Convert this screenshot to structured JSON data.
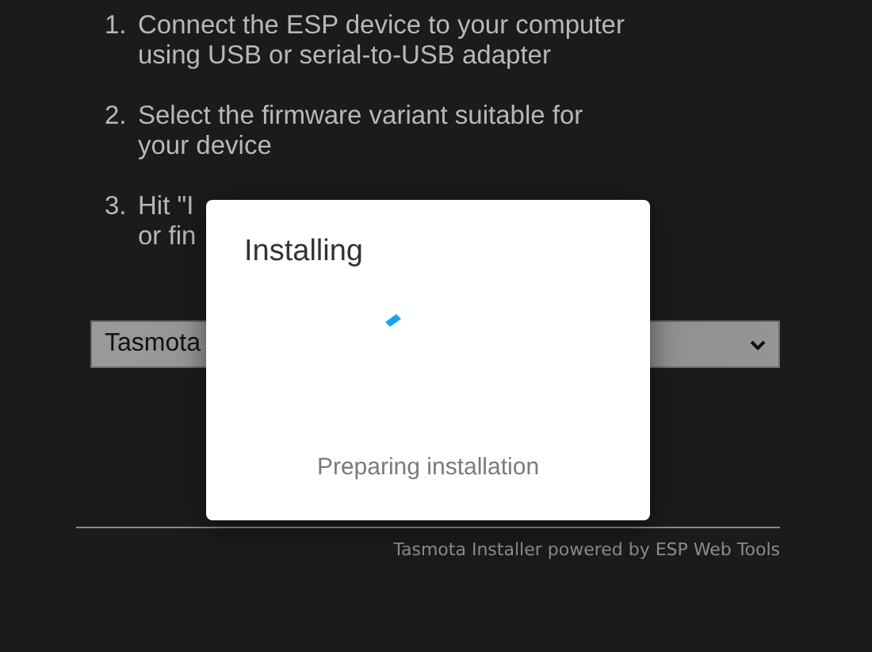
{
  "steps": [
    {
      "number": "1.",
      "lines": [
        "Connect the ESP device to your computer",
        "using USB or serial-to-USB adapter"
      ]
    },
    {
      "number": "2.",
      "lines": [
        "Select the firmware variant suitable for",
        "your device"
      ]
    },
    {
      "number": "3.",
      "lines": [
        "Hit \"I",
        "or fin"
      ]
    }
  ],
  "firmware_select": {
    "value": "Tasmota"
  },
  "footer": "Tasmota Installer powered by ESP Web Tools",
  "dialog": {
    "title": "Installing",
    "status": "Preparing installation"
  }
}
